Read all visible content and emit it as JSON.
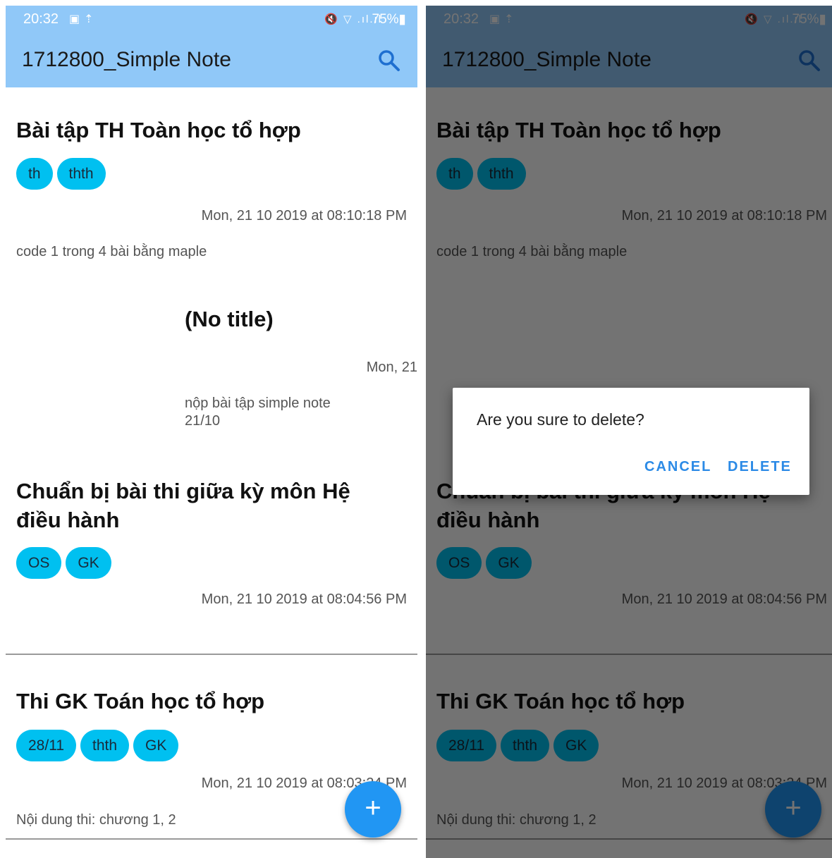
{
  "status_bar": {
    "time": "20:32",
    "left_icons": [
      "image-icon",
      "upload-icon"
    ],
    "right_icons": [
      "mute-icon",
      "wifi-icon",
      "signal-icon"
    ],
    "signal_glyphs": "🔇 ▽ .ıl.ıl",
    "battery": "75%"
  },
  "app_bar": {
    "title": "1712800_Simple Note",
    "search_icon": "search-icon"
  },
  "notes": [
    {
      "title": "Bài tập TH Toàn học tổ hợp",
      "tags": [
        "th",
        "thth"
      ],
      "date": "Mon, 21 10 2019 at 08:10:18 PM",
      "body": "code 1 trong 4 bài bằng maple"
    },
    {
      "title": "(No title)",
      "tags": [],
      "date": "Mon, 21",
      "body_lines": [
        "nộp bài tập simple note",
        "21/10"
      ]
    },
    {
      "title_lines": [
        "Chuẩn bị bài thi giữa kỳ môn Hệ",
        "điều hành"
      ],
      "tags": [
        "OS",
        "GK"
      ],
      "date": "Mon, 21 10 2019 at 08:04:56 PM",
      "body": ""
    },
    {
      "title": "Thi GK Toán học tổ hợp",
      "tags": [
        "28/11",
        "thth",
        "GK"
      ],
      "date": "Mon, 21 10 2019 at 08:03:24 PM",
      "body": "Nội dung thi: chương 1, 2"
    }
  ],
  "fab": {
    "icon": "plus-icon",
    "label": "+"
  },
  "dialog": {
    "message": "Are you sure to delete?",
    "cancel_label": "CANCEL",
    "delete_label": "DELETE"
  },
  "colors": {
    "app_bar": "#90c8f8",
    "tag": "#00c0f0",
    "fab": "#2196f3",
    "dialog_button": "#2b8ae6"
  }
}
